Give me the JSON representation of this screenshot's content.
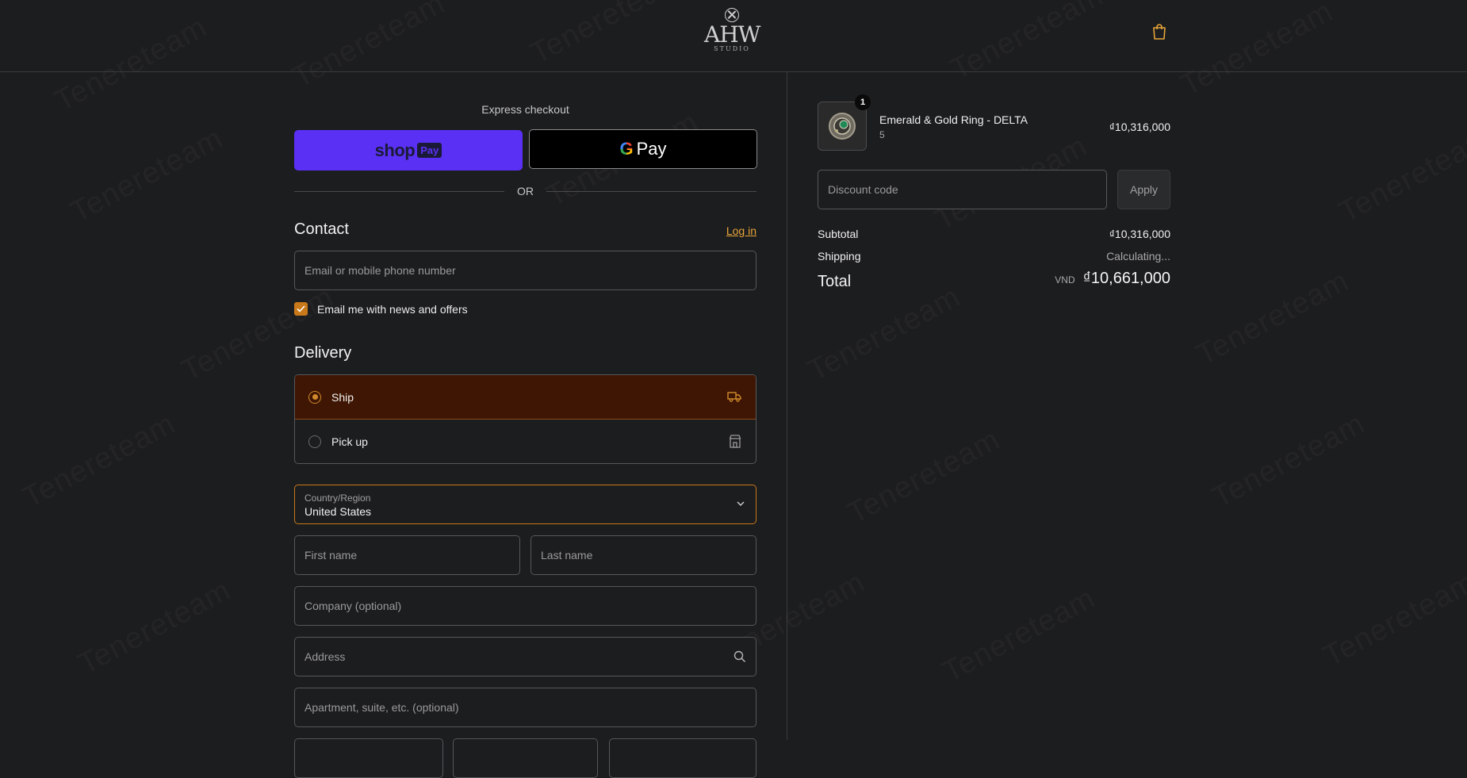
{
  "brand": {
    "logo_word": "AHW",
    "logo_sub": "STUDIO"
  },
  "watermark": "Tenereteam",
  "express": {
    "title": "Express checkout",
    "shop_pay": "shop",
    "shop_pay_badge": "Pay",
    "gpay_g": "G",
    "gpay_label": "Pay",
    "or_label": "OR"
  },
  "contact": {
    "title": "Contact",
    "login": "Log in",
    "email_placeholder": "Email or mobile phone number",
    "news_label": "Email me with news and offers",
    "news_checked": true
  },
  "delivery": {
    "title": "Delivery",
    "options": [
      {
        "label": "Ship",
        "selected": true,
        "icon": "truck-icon"
      },
      {
        "label": "Pick up",
        "selected": false,
        "icon": "store-icon"
      }
    ],
    "country_label": "Country/Region",
    "country_value": "United States",
    "first_name": "First name",
    "last_name": "Last name",
    "company": "Company (optional)",
    "address": "Address",
    "apartment": "Apartment, suite, etc. (optional)"
  },
  "summary": {
    "product_name": "Emerald & Gold Ring - DELTA",
    "product_variant": "5",
    "product_qty": "1",
    "product_price": "₫10,316,000",
    "discount_placeholder": "Discount code",
    "apply_label": "Apply",
    "subtotal_label": "Subtotal",
    "subtotal_value": "₫10,316,000",
    "shipping_label": "Shipping",
    "shipping_value": "Calculating...",
    "total_label": "Total",
    "total_currency": "VND",
    "total_value": "₫10,661,000"
  },
  "colors": {
    "accent": "#c8791a",
    "background": "#1c1d1f",
    "selected_bg": "#3f1603",
    "shop_pay": "#5a31f4"
  }
}
